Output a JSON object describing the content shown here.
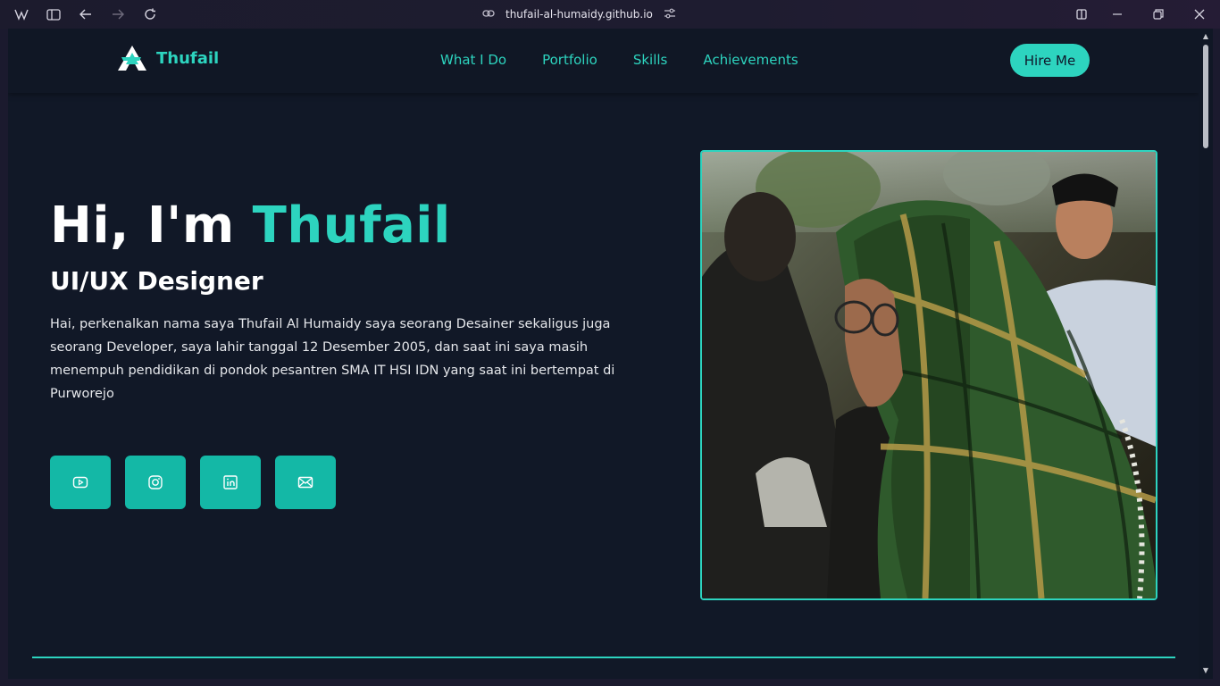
{
  "browser": {
    "url": "thufail-al-humaidy.github.io",
    "icons": [
      "browser-logo-icon",
      "sidebar-toggle-icon",
      "back-icon",
      "forward-icon",
      "reload-icon",
      "link-icon",
      "site-settings-icon",
      "split-view-icon",
      "minimize-icon",
      "restore-icon",
      "close-icon"
    ]
  },
  "navbar": {
    "brand": "Thufail",
    "links": [
      "What I Do",
      "Portfolio",
      "Skills",
      "Achievements"
    ],
    "cta": "Hire Me"
  },
  "hero": {
    "greeting": "Hi, I'm ",
    "name": "Thufail",
    "role": "UI/UX Designer",
    "description": "Hai, perkenalkan nama saya Thufail Al Humaidy saya seorang Desainer sekaligus juga seorang Developer, saya lahir tanggal 12 Desember 2005, dan saat ini saya masih menempuh pendidikan di pondok pesantren SMA IT HSI IDN yang saat ini bertempat di Purworejo",
    "socials": [
      "youtube-icon",
      "instagram-icon",
      "linkedin-icon",
      "mail-icon"
    ]
  },
  "colors": {
    "accent": "#2dd4bf",
    "button": "#14b8a6",
    "background": "#111827"
  }
}
